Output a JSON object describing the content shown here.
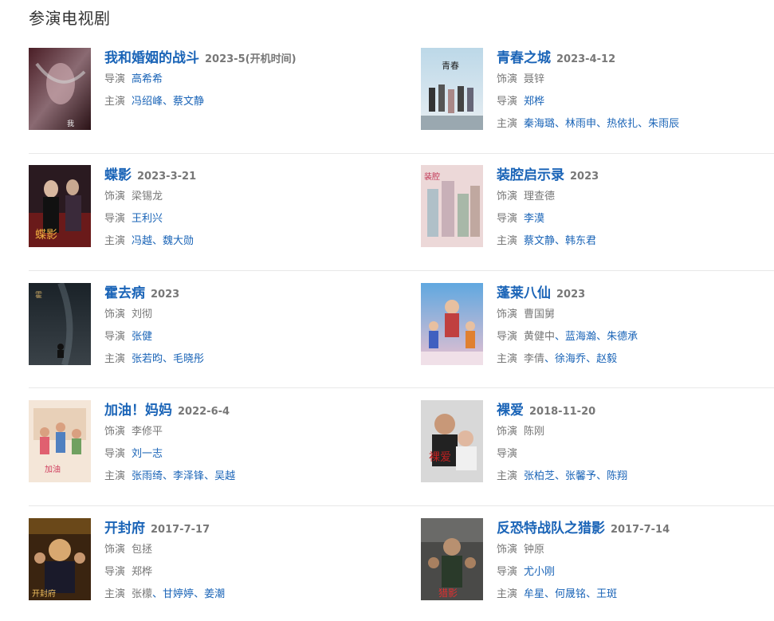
{
  "section_title": "参演电视剧",
  "labels": {
    "actor": "饰演",
    "director": "导演",
    "star": "主演",
    "sep": "、"
  },
  "left": [
    {
      "title": "我和婚姻的战斗",
      "date": "2023-5(开机时间)",
      "rows": [
        {
          "label": "导演",
          "links": [
            "高希希"
          ]
        },
        {
          "label": "主演",
          "links": [
            "冯绍峰",
            "蔡文静"
          ]
        }
      ]
    },
    {
      "title": "蝶影",
      "date": "2023-3-21",
      "rows": [
        {
          "label": "饰演",
          "plain": "梁锡龙"
        },
        {
          "label": "导演",
          "links": [
            "王利兴"
          ]
        },
        {
          "label": "主演",
          "links": [
            "冯越",
            "魏大勋"
          ]
        }
      ]
    },
    {
      "title": "霍去病",
      "date": "2023",
      "rows": [
        {
          "label": "饰演",
          "plain": "刘彻"
        },
        {
          "label": "导演",
          "links": [
            "张健"
          ]
        },
        {
          "label": "主演",
          "links": [
            "张若昀",
            "毛晓彤"
          ]
        }
      ]
    },
    {
      "title": "加油！妈妈",
      "date": "2022-6-4",
      "rows": [
        {
          "label": "饰演",
          "plain": "李修平"
        },
        {
          "label": "导演",
          "links": [
            "刘一志"
          ]
        },
        {
          "label": "主演",
          "links": [
            "张雨绮",
            "李泽锋",
            "吴越"
          ]
        }
      ]
    },
    {
      "title": "开封府",
      "date": "2017-7-17",
      "rows": [
        {
          "label": "饰演",
          "plain": "包拯"
        },
        {
          "label": "导演",
          "links": [
            "郑桦"
          ],
          "plain_link": true
        },
        {
          "label": "主演",
          "links": [
            "张檬",
            "甘婷婷",
            "姜潮"
          ],
          "first_plain": true
        }
      ]
    }
  ],
  "right": [
    {
      "title": "青春之城",
      "date": "2023-4-12",
      "rows": [
        {
          "label": "饰演",
          "plain": "聂锌"
        },
        {
          "label": "导演",
          "links": [
            "郑桦"
          ]
        },
        {
          "label": "主演",
          "links": [
            "秦海璐",
            "林雨申",
            "热依扎",
            "朱雨辰"
          ]
        }
      ]
    },
    {
      "title": "装腔启示录",
      "date": "2023",
      "rows": [
        {
          "label": "饰演",
          "plain": "理查德"
        },
        {
          "label": "导演",
          "links": [
            "李漠"
          ]
        },
        {
          "label": "主演",
          "links": [
            "蔡文静",
            "韩东君"
          ]
        }
      ]
    },
    {
      "title": "蓬莱八仙",
      "date": "2023",
      "rows": [
        {
          "label": "饰演",
          "plain": "曹国舅"
        },
        {
          "label": "导演",
          "links": [
            "黄健中",
            "蓝海瀚",
            "朱德承"
          ],
          "first_plain": true
        },
        {
          "label": "主演",
          "links": [
            "李倩",
            "徐海乔",
            "赵毅"
          ],
          "first_plain": true
        }
      ]
    },
    {
      "title": "裸爱",
      "date": "2018-11-20",
      "rows": [
        {
          "label": "饰演",
          "plain": "陈刚"
        },
        {
          "label": "导演",
          "links": []
        },
        {
          "label": "主演",
          "links": [
            "张柏芝",
            "张馨予",
            "陈翔"
          ]
        }
      ]
    },
    {
      "title": "反恐特战队之猎影",
      "date": "2017-7-14",
      "rows": [
        {
          "label": "饰演",
          "plain": "钟原"
        },
        {
          "label": "导演",
          "links": [
            "尤小刚"
          ]
        },
        {
          "label": "主演",
          "links": [
            "牟星",
            "何晟铭",
            "王斑"
          ]
        }
      ]
    }
  ],
  "colors": {
    "link": "#1a64b7",
    "muted": "#777777",
    "divider": "#e8e8e8"
  }
}
